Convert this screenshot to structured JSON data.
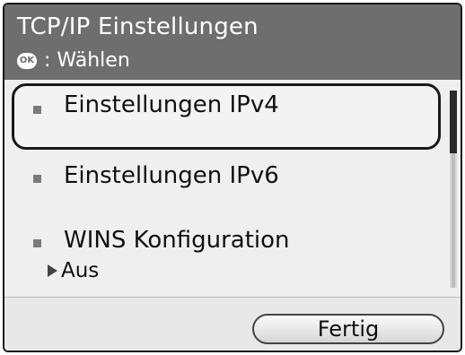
{
  "header": {
    "title": "TCP/IP Einstellungen",
    "hint_icon": "OK",
    "hint_text": ": Wählen"
  },
  "list": {
    "items": [
      {
        "label": "Einstellungen IPv4",
        "selected": true
      },
      {
        "label": "Einstellungen IPv6",
        "selected": false
      },
      {
        "label": "WINS Konfiguration",
        "sub_value": "Aus",
        "selected": false
      }
    ]
  },
  "footer": {
    "done_label": "Fertig"
  },
  "colors": {
    "header_bg": "#6e6e6e",
    "screen_bg": "#efefef",
    "selection_border": "#1a1a1a"
  }
}
